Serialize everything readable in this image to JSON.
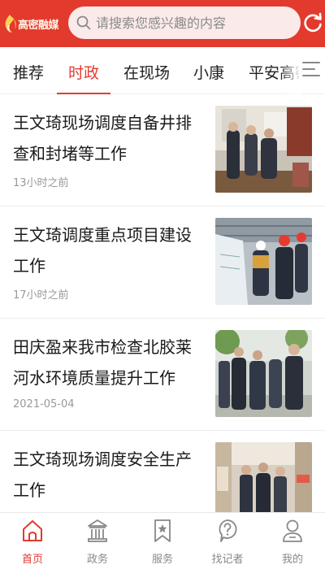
{
  "header": {
    "logo_text": "高密融媒",
    "search_placeholder": "请搜索您感兴趣的内容",
    "brand_color": "#e33a2e"
  },
  "tabs": [
    {
      "label": "推荐",
      "active": false
    },
    {
      "label": "时政",
      "active": true
    },
    {
      "label": "在现场",
      "active": false
    },
    {
      "label": "小康",
      "active": false
    },
    {
      "label": "平安高密",
      "active": false
    }
  ],
  "feed": [
    {
      "title": "王文琦现场调度自备井排查和封堵等工作",
      "time": "13小时之前",
      "thumbnail": "meeting-room-photo"
    },
    {
      "title": "王文琦调度重点项目建设工作",
      "time": "17小时之前",
      "thumbnail": "construction-site-photo"
    },
    {
      "title": "田庆盈来我市检查北胶莱河水环境质量提升工作",
      "time": "2021-05-04",
      "thumbnail": "riverside-inspection-photo"
    },
    {
      "title": "王文琦现场调度安全生产工作",
      "time": "",
      "thumbnail": "market-inspection-photo"
    }
  ],
  "bottom_nav": [
    {
      "label": "首页",
      "icon": "home-icon",
      "active": true
    },
    {
      "label": "政务",
      "icon": "government-icon",
      "active": false
    },
    {
      "label": "服务",
      "icon": "bookmark-star-icon",
      "active": false
    },
    {
      "label": "找记者",
      "icon": "question-bubble-icon",
      "active": false
    },
    {
      "label": "我的",
      "icon": "user-icon",
      "active": false
    }
  ]
}
